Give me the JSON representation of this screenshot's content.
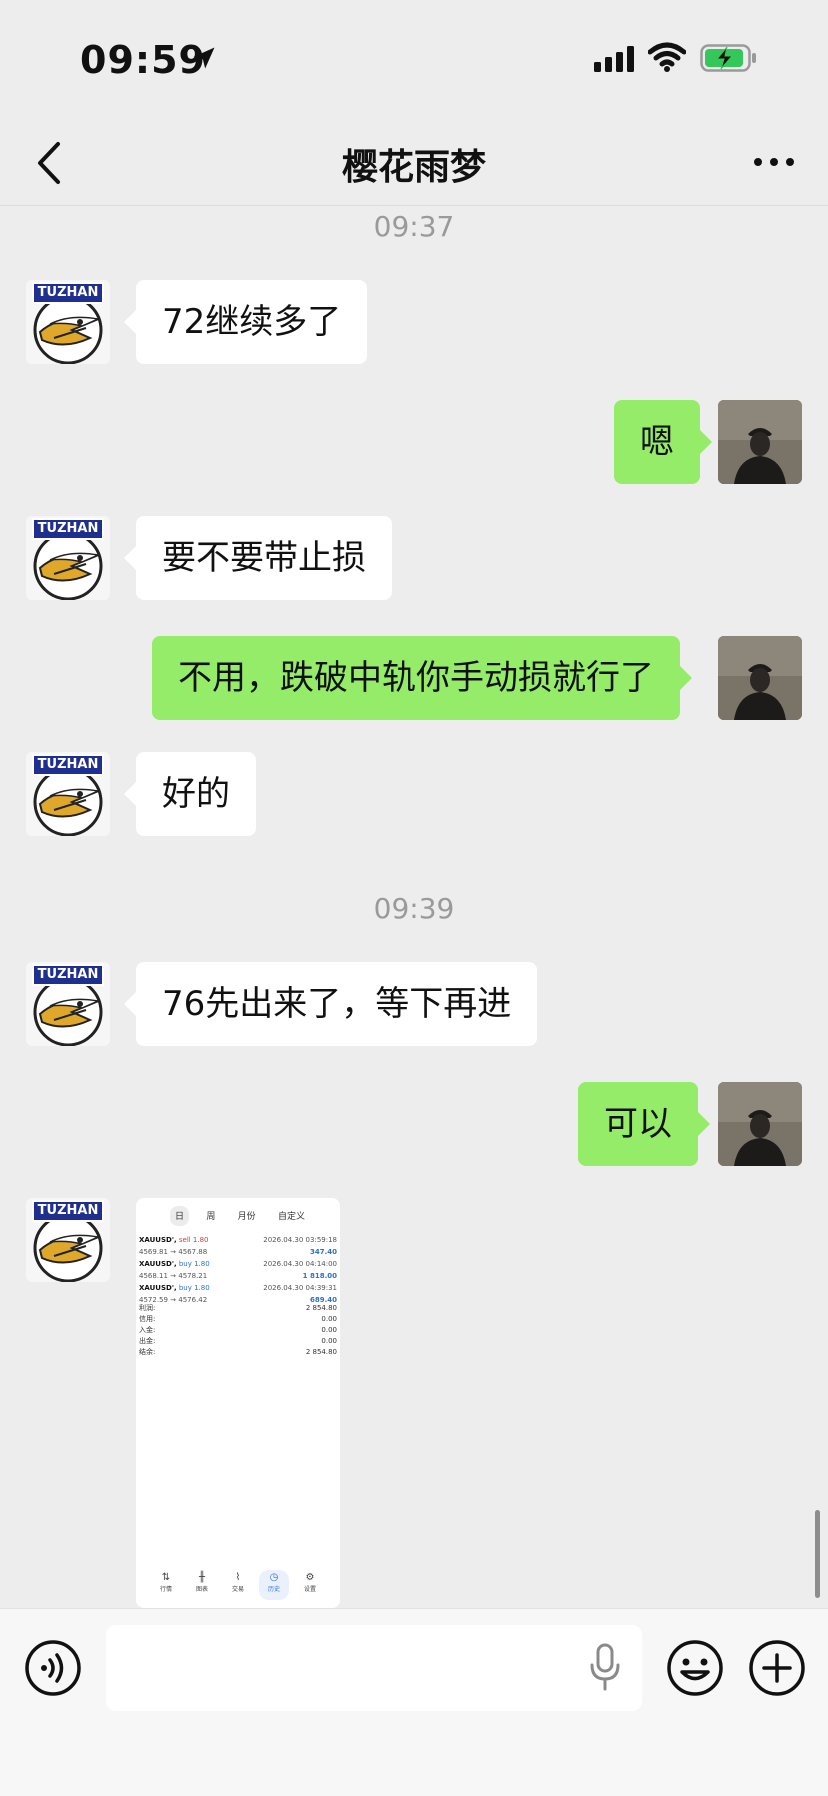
{
  "status": {
    "time": "09:59",
    "icons": [
      "location-arrow-icon",
      "cellular-signal-icon",
      "wifi-icon",
      "battery-charging-icon"
    ],
    "battery_color": "#34c759"
  },
  "nav": {
    "title": "樱花雨梦",
    "back_icon": "chevron-left-icon",
    "more_icon": "more-dots-icon"
  },
  "contact": {
    "avatar_banner": "TUZHAN"
  },
  "messages": [
    {
      "type": "timestamp",
      "text": "09:37"
    },
    {
      "type": "text",
      "from": "them",
      "text": "72继续多了"
    },
    {
      "type": "text",
      "from": "me",
      "text": "嗯"
    },
    {
      "type": "text",
      "from": "them",
      "text": "要不要带止损"
    },
    {
      "type": "text",
      "from": "me",
      "text": "不用，跌破中轨你手动损就行了"
    },
    {
      "type": "text",
      "from": "them",
      "text": "好的"
    },
    {
      "type": "timestamp",
      "text": "09:39"
    },
    {
      "type": "text",
      "from": "them",
      "text": "76先出来了，等下再进"
    },
    {
      "type": "text",
      "from": "me",
      "text": "可以"
    },
    {
      "type": "image",
      "from": "them"
    }
  ],
  "image_message": {
    "tabs": [
      "日",
      "周",
      "月份",
      "自定义"
    ],
    "active_tab": "日",
    "trades": [
      {
        "symbol": "XAUUSD',",
        "side": "sell 1.80",
        "time": "2026.04.30 03:59:18",
        "prices": "4569.81 → 4567.88",
        "profit": "347.40"
      },
      {
        "symbol": "XAUUSD',",
        "side": "buy 1.80",
        "time": "2026.04.30 04:14:00",
        "prices": "4568.11 → 4578.21",
        "profit": "1 818.00"
      },
      {
        "symbol": "XAUUSD',",
        "side": "buy 1.80",
        "time": "2026.04.30 04:39:31",
        "prices": "4572.59 → 4576.42",
        "profit": "689.40"
      }
    ],
    "summary": [
      {
        "label": "利润:",
        "value": "2 854.80"
      },
      {
        "label": "信用:",
        "value": "0.00"
      },
      {
        "label": "入金:",
        "value": "0.00"
      },
      {
        "label": "出金:",
        "value": "0.00"
      },
      {
        "label": "结余:",
        "value": "2 854.80"
      }
    ],
    "bottom_nav": [
      {
        "label": "行情",
        "icon": "updown-arrows-icon"
      },
      {
        "label": "图表",
        "icon": "candlestick-icon"
      },
      {
        "label": "交易",
        "icon": "trade-chart-icon"
      },
      {
        "label": "历史",
        "icon": "history-clock-icon",
        "active": true
      },
      {
        "label": "设置",
        "icon": "settings-gear-icon"
      }
    ]
  },
  "input": {
    "value": "",
    "placeholder": "",
    "voice_icon": "voice-mode-icon",
    "mic_icon": "microphone-icon",
    "emoji_icon": "emoji-icon",
    "plus_icon": "plus-icon"
  },
  "colors": {
    "background": "#ededed",
    "my_bubble": "#95ec69",
    "their_bubble": "#ffffff",
    "avatar_banner": "#1f2f8f"
  }
}
